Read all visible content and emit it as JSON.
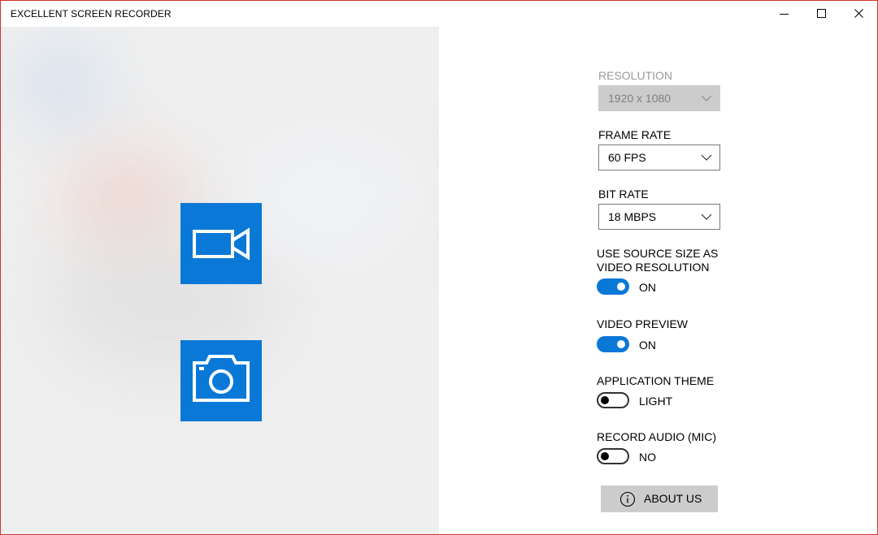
{
  "window": {
    "title": "EXCELLENT SCREEN RECORDER",
    "controls": {
      "minimize": "minimize",
      "maximize": "maximize",
      "close": "close"
    },
    "border_color": "#d0362b"
  },
  "preview": {
    "record_icon": "video-camera-icon",
    "screenshot_icon": "photo-camera-icon",
    "tile_color": "#0a78d7"
  },
  "settings": {
    "resolution": {
      "label": "RESOLUTION",
      "value": "1920 x 1080",
      "enabled": false
    },
    "frame_rate": {
      "label": "FRAME RATE",
      "value": "60 FPS"
    },
    "bit_rate": {
      "label": "BIT RATE",
      "value": "18 MBPS"
    },
    "use_source_size": {
      "label_line1": "USE SOURCE SIZE AS",
      "label_line2": "VIDEO RESOLUTION",
      "state": "ON",
      "on": true
    },
    "video_preview": {
      "label": "VIDEO PREVIEW",
      "state": "ON",
      "on": true
    },
    "app_theme": {
      "label": "APPLICATION THEME",
      "state": "LIGHT",
      "on": false
    },
    "record_audio": {
      "label": "RECORD AUDIO (MIC)",
      "state": "NO",
      "on": false
    },
    "about": {
      "label": "ABOUT US",
      "icon": "info-icon"
    },
    "accent_color": "#0a78d7"
  }
}
